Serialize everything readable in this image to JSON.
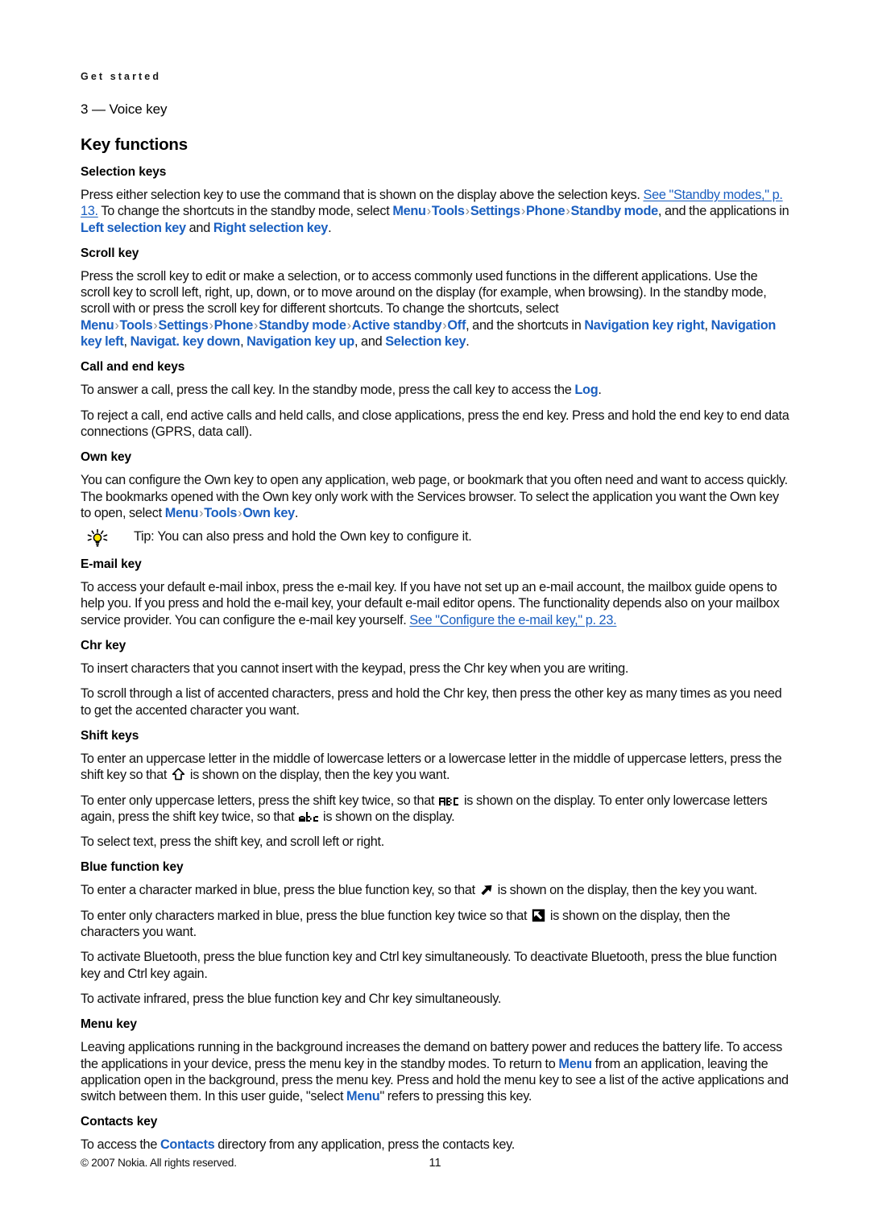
{
  "header": {
    "running_head": "Get started"
  },
  "item_line": "3 — Voice key",
  "section": {
    "title": "Key functions"
  },
  "colors": {
    "ui_term": "#1a5fc0",
    "separator": "#8c8c8c",
    "text": "#111111",
    "tip_bulb": "#ffe800"
  },
  "selection_keys": {
    "heading": "Selection keys",
    "p1": {
      "t1": "Press either selection key to use the command that is shown on the display above the selection keys. ",
      "xref1": "See \"Standby modes,\" p. 13.",
      "t2": " To change the shortcuts in the standby mode, select ",
      "ui1": "Menu",
      "sep1": "›",
      "ui2": "Tools",
      "sep2": "›",
      "ui3": "Settings",
      "sep3": "›",
      "ui4": "Phone",
      "sep4": "›",
      "ui5": "Standby mode",
      "t3": ", and the applications in ",
      "ui6": "Left selection key",
      "t4": " and ",
      "ui7": "Right selection key",
      "t5": "."
    }
  },
  "scroll_key": {
    "heading": "Scroll key",
    "p1": {
      "t1": "Press the scroll key to edit or make a selection, or to access commonly used functions in the different applications. Use the scroll key to scroll left, right, up, down, or to move around on the display (for example, when browsing). In the standby mode, scroll with or press the scroll key for different shortcuts. To change the shortcuts, select ",
      "ui1": "Menu",
      "sep1": "›",
      "ui2": "Tools",
      "sep2": "›",
      "ui3": "Settings",
      "sep3": "›",
      "ui4": "Phone",
      "sep4": "›",
      "ui5": "Standby mode",
      "sep5": "›",
      "ui6": "Active standby",
      "sep6": "›",
      "ui7": "Off",
      "t2": ", and the shortcuts in ",
      "ui8": "Navigation key right",
      "t3": ", ",
      "ui9": "Navigation key left",
      "t4": ", ",
      "ui10": "Navigat. key down",
      "t5": ", ",
      "ui11": "Navigation key up",
      "t6": ", and ",
      "ui12": "Selection key",
      "t7": "."
    }
  },
  "call_end_keys": {
    "heading": "Call and end keys",
    "p1": {
      "t1": "To answer a call, press the call key. In the standby mode, press the call key to access the ",
      "ui1": "Log",
      "t2": "."
    },
    "p2": "To reject a call, end active calls and held calls, and close applications, press the end key. Press and hold the end key to end data connections (GPRS, data call)."
  },
  "own_key": {
    "heading": "Own key",
    "p1": {
      "t1": "You can configure the Own key to open any application, web page, or bookmark that you often need and want to access quickly. The bookmarks opened with the Own key only work with the Services browser. To select the application you want the Own key to open, select ",
      "ui1": "Menu",
      "sep1": "›",
      "ui2": "Tools",
      "sep2": "›",
      "ui3": "Own key",
      "t2": "."
    },
    "tip": {
      "icon": "lightbulb-tip-icon",
      "text": "Tip: You can also press and hold the Own key to configure it."
    }
  },
  "email_key": {
    "heading": "E-mail key",
    "p1": {
      "t1": "To access your default e-mail inbox, press the e-mail key. If you have not set up an e-mail account, the mailbox guide opens to help you. If you press and hold the e-mail key, your default e-mail editor opens. The functionality depends also on your mailbox service provider. You can configure the e-mail key yourself. ",
      "xref1": "See \"Configure the e-mail key,\" p. 23."
    }
  },
  "chr_key": {
    "heading": "Chr key",
    "p1": "To insert characters that you cannot insert with the keypad, press the Chr key when you are writing.",
    "p2": "To scroll through a list of accented characters, press and hold the Chr key, then press the other key as many times as you need to get the accented character you want."
  },
  "shift_keys": {
    "heading": "Shift keys",
    "p1": {
      "t1": "To enter an uppercase letter in the middle of lowercase letters or a lowercase letter in the middle of uppercase letters, press the shift key so that ",
      "icon1": "shift-arrow-up-icon",
      "t2": " is shown on the display, then the key you want."
    },
    "p2": {
      "t1": "To enter only uppercase letters, press the shift key twice, so that ",
      "icon1": "abc-uppercase-indicator-icon",
      "icon1_label": "ABC",
      "t2": " is shown on the display. To enter only lowercase letters again, press the shift key twice, so that ",
      "icon2": "abc-lowercase-indicator-icon",
      "icon2_label": "abc",
      "t3": " is shown on the display."
    },
    "p3": "To select text, press the shift key, and scroll left or right."
  },
  "blue_function_key": {
    "heading": "Blue function key",
    "p1": {
      "t1": "To enter a character marked in blue, press the blue function key, so that ",
      "icon1": "blue-function-arrow-icon",
      "t2": " is shown on the display, then the key you want."
    },
    "p2": {
      "t1": "To enter only characters marked in blue, press the blue function key twice so that ",
      "icon1": "blue-function-arrow-boxed-icon",
      "t2": " is shown on the display, then the characters you want."
    },
    "p3": "To activate Bluetooth, press the blue function key and Ctrl key simultaneously. To deactivate Bluetooth, press the blue function key and Ctrl key again.",
    "p4": "To activate infrared, press the blue function key and Chr key simultaneously."
  },
  "menu_key": {
    "heading": "Menu key",
    "p1": {
      "t1": "Leaving applications running in the background increases the demand on battery power and reduces the battery life. To access the applications in your device, press the menu key in the standby modes. To return to ",
      "ui1": "Menu",
      "t2": " from an application, leaving the application open in the background, press the menu key. Press and hold the menu key to see a list of the active applications and switch between them. In this user guide, \"select ",
      "ui2": "Menu",
      "t3": "\" refers to pressing this key."
    }
  },
  "contacts_key": {
    "heading": "Contacts key",
    "p1": {
      "t1": "To access the ",
      "ui1": "Contacts",
      "t2": " directory from any application, press the contacts key."
    }
  },
  "footer": {
    "copyright": "© 2007 Nokia. All rights reserved.",
    "page_number": "11"
  }
}
